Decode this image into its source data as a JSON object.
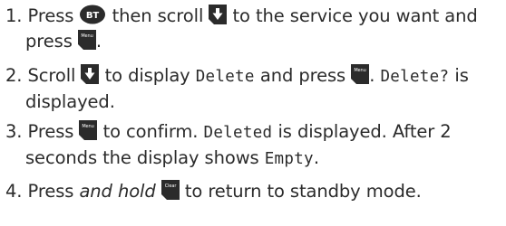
{
  "colors": {
    "icon_fill": "#2b2b2b",
    "icon_text": "#ffffff",
    "text": "#2b2b2b"
  },
  "icons": {
    "bt": {
      "name": "bt-button-icon",
      "label": "BT"
    },
    "down": {
      "name": "scroll-down-arrow-icon",
      "label": "▼"
    },
    "menu": {
      "name": "menu-button-icon",
      "label": "Menu"
    },
    "clear": {
      "name": "clear-button-icon",
      "label": "Clear"
    }
  },
  "steps": [
    {
      "number": "1.",
      "t1": "Press",
      "t2": "then scroll",
      "t3": "to the service you want and",
      "t4": "press",
      "t5": "."
    },
    {
      "number": "2.",
      "t1": "Scroll",
      "t2": "to display",
      "lcd1": "Delete",
      "t3": "and press",
      "t4": ".",
      "lcd2": "Delete?",
      "t5": "is",
      "t6": "displayed."
    },
    {
      "number": "3.",
      "t1": "Press",
      "t2": "to confirm.",
      "lcd1": "Deleted",
      "t3": "is displayed. After 2",
      "t4": "seconds the display shows",
      "lcd2": "Empty",
      "t5": "."
    },
    {
      "number": "4.",
      "t1": "Press",
      "t1_emph": "and hold",
      "t2": "to return to standby mode."
    }
  ]
}
